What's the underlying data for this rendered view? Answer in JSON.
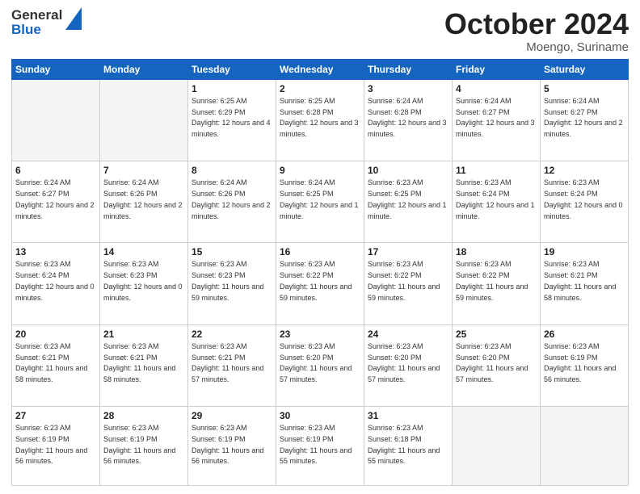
{
  "header": {
    "logo_general": "General",
    "logo_blue": "Blue",
    "month_title": "October 2024",
    "location": "Moengo, Suriname"
  },
  "days_of_week": [
    "Sunday",
    "Monday",
    "Tuesday",
    "Wednesday",
    "Thursday",
    "Friday",
    "Saturday"
  ],
  "weeks": [
    [
      {
        "day": "",
        "info": ""
      },
      {
        "day": "",
        "info": ""
      },
      {
        "day": "1",
        "info": "Sunrise: 6:25 AM\nSunset: 6:29 PM\nDaylight: 12 hours and 4 minutes."
      },
      {
        "day": "2",
        "info": "Sunrise: 6:25 AM\nSunset: 6:28 PM\nDaylight: 12 hours and 3 minutes."
      },
      {
        "day": "3",
        "info": "Sunrise: 6:24 AM\nSunset: 6:28 PM\nDaylight: 12 hours and 3 minutes."
      },
      {
        "day": "4",
        "info": "Sunrise: 6:24 AM\nSunset: 6:27 PM\nDaylight: 12 hours and 3 minutes."
      },
      {
        "day": "5",
        "info": "Sunrise: 6:24 AM\nSunset: 6:27 PM\nDaylight: 12 hours and 2 minutes."
      }
    ],
    [
      {
        "day": "6",
        "info": "Sunrise: 6:24 AM\nSunset: 6:27 PM\nDaylight: 12 hours and 2 minutes."
      },
      {
        "day": "7",
        "info": "Sunrise: 6:24 AM\nSunset: 6:26 PM\nDaylight: 12 hours and 2 minutes."
      },
      {
        "day": "8",
        "info": "Sunrise: 6:24 AM\nSunset: 6:26 PM\nDaylight: 12 hours and 2 minutes."
      },
      {
        "day": "9",
        "info": "Sunrise: 6:24 AM\nSunset: 6:25 PM\nDaylight: 12 hours and 1 minute."
      },
      {
        "day": "10",
        "info": "Sunrise: 6:23 AM\nSunset: 6:25 PM\nDaylight: 12 hours and 1 minute."
      },
      {
        "day": "11",
        "info": "Sunrise: 6:23 AM\nSunset: 6:24 PM\nDaylight: 12 hours and 1 minute."
      },
      {
        "day": "12",
        "info": "Sunrise: 6:23 AM\nSunset: 6:24 PM\nDaylight: 12 hours and 0 minutes."
      }
    ],
    [
      {
        "day": "13",
        "info": "Sunrise: 6:23 AM\nSunset: 6:24 PM\nDaylight: 12 hours and 0 minutes."
      },
      {
        "day": "14",
        "info": "Sunrise: 6:23 AM\nSunset: 6:23 PM\nDaylight: 12 hours and 0 minutes."
      },
      {
        "day": "15",
        "info": "Sunrise: 6:23 AM\nSunset: 6:23 PM\nDaylight: 11 hours and 59 minutes."
      },
      {
        "day": "16",
        "info": "Sunrise: 6:23 AM\nSunset: 6:22 PM\nDaylight: 11 hours and 59 minutes."
      },
      {
        "day": "17",
        "info": "Sunrise: 6:23 AM\nSunset: 6:22 PM\nDaylight: 11 hours and 59 minutes."
      },
      {
        "day": "18",
        "info": "Sunrise: 6:23 AM\nSunset: 6:22 PM\nDaylight: 11 hours and 59 minutes."
      },
      {
        "day": "19",
        "info": "Sunrise: 6:23 AM\nSunset: 6:21 PM\nDaylight: 11 hours and 58 minutes."
      }
    ],
    [
      {
        "day": "20",
        "info": "Sunrise: 6:23 AM\nSunset: 6:21 PM\nDaylight: 11 hours and 58 minutes."
      },
      {
        "day": "21",
        "info": "Sunrise: 6:23 AM\nSunset: 6:21 PM\nDaylight: 11 hours and 58 minutes."
      },
      {
        "day": "22",
        "info": "Sunrise: 6:23 AM\nSunset: 6:21 PM\nDaylight: 11 hours and 57 minutes."
      },
      {
        "day": "23",
        "info": "Sunrise: 6:23 AM\nSunset: 6:20 PM\nDaylight: 11 hours and 57 minutes."
      },
      {
        "day": "24",
        "info": "Sunrise: 6:23 AM\nSunset: 6:20 PM\nDaylight: 11 hours and 57 minutes."
      },
      {
        "day": "25",
        "info": "Sunrise: 6:23 AM\nSunset: 6:20 PM\nDaylight: 11 hours and 57 minutes."
      },
      {
        "day": "26",
        "info": "Sunrise: 6:23 AM\nSunset: 6:19 PM\nDaylight: 11 hours and 56 minutes."
      }
    ],
    [
      {
        "day": "27",
        "info": "Sunrise: 6:23 AM\nSunset: 6:19 PM\nDaylight: 11 hours and 56 minutes."
      },
      {
        "day": "28",
        "info": "Sunrise: 6:23 AM\nSunset: 6:19 PM\nDaylight: 11 hours and 56 minutes."
      },
      {
        "day": "29",
        "info": "Sunrise: 6:23 AM\nSunset: 6:19 PM\nDaylight: 11 hours and 56 minutes."
      },
      {
        "day": "30",
        "info": "Sunrise: 6:23 AM\nSunset: 6:19 PM\nDaylight: 11 hours and 55 minutes."
      },
      {
        "day": "31",
        "info": "Sunrise: 6:23 AM\nSunset: 6:18 PM\nDaylight: 11 hours and 55 minutes."
      },
      {
        "day": "",
        "info": ""
      },
      {
        "day": "",
        "info": ""
      }
    ]
  ]
}
